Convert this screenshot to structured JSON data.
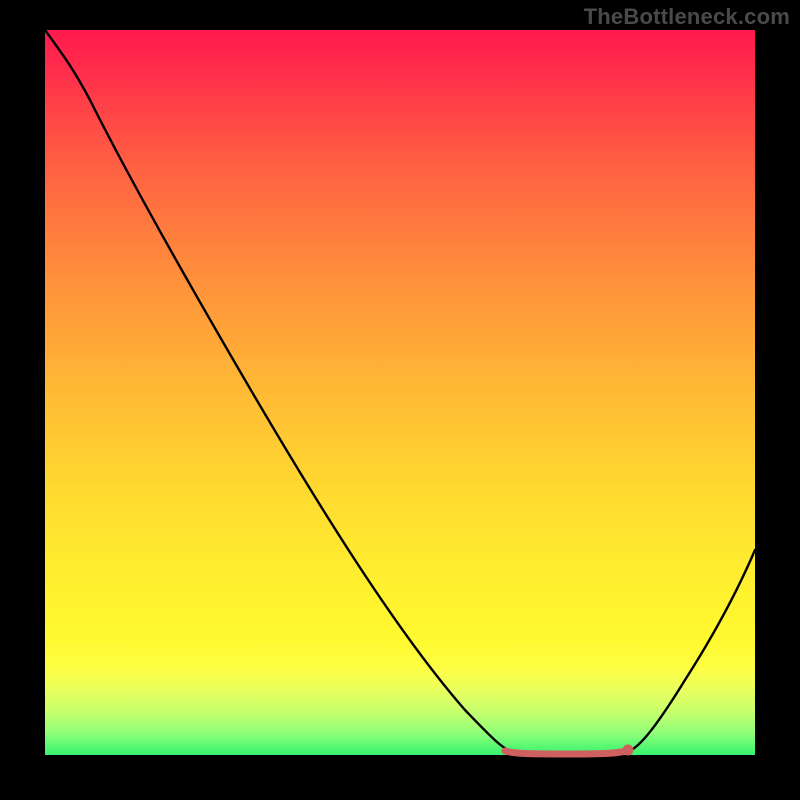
{
  "watermark": "TheBottleneck.com",
  "colors": {
    "page_bg": "#000000",
    "watermark_text": "#4a4a4a",
    "curve_stroke": "#000000",
    "accent_stroke": "#d46a6a",
    "accent_dot": "#d46a6a"
  },
  "chart_data": {
    "type": "line",
    "title": "",
    "xlabel": "",
    "ylabel": "",
    "xlim": [
      0,
      100
    ],
    "ylim": [
      0,
      100
    ],
    "series": [
      {
        "name": "bottleneck-curve",
        "x": [
          0,
          4,
          8,
          14,
          20,
          28,
          36,
          44,
          52,
          58,
          62,
          65,
          68,
          71,
          74,
          77,
          80,
          84,
          88,
          92,
          96,
          100
        ],
        "values": [
          100,
          98,
          95,
          88,
          80,
          68,
          56,
          44,
          32,
          22,
          14,
          8,
          4,
          1,
          0,
          0,
          0,
          3,
          9,
          17,
          27,
          38
        ]
      }
    ],
    "annotations": [
      {
        "name": "flat-minimum-highlight",
        "x_start": 65,
        "x_end": 81,
        "y": 0
      },
      {
        "name": "endpoint-dot",
        "x": 81,
        "y": 0
      }
    ]
  }
}
